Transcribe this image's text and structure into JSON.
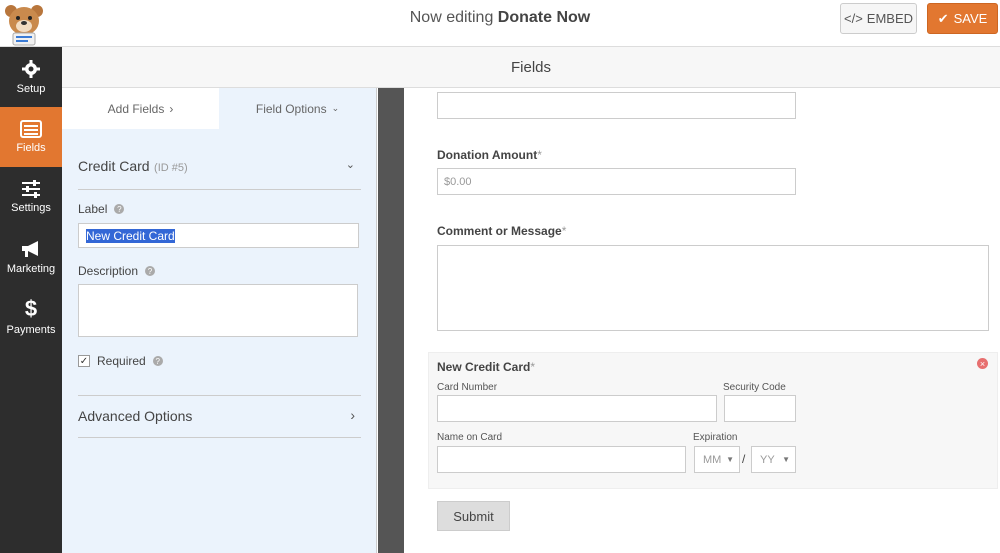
{
  "header": {
    "editing_prefix": "Now editing",
    "form_name": "Donate Now",
    "embed_label": "EMBED",
    "save_label": "SAVE"
  },
  "nav": {
    "items": [
      {
        "label": "Setup",
        "icon": "gear-icon"
      },
      {
        "label": "Fields",
        "icon": "list-icon",
        "active": true
      },
      {
        "label": "Settings",
        "icon": "sliders-icon"
      },
      {
        "label": "Marketing",
        "icon": "megaphone-icon"
      },
      {
        "label": "Payments",
        "icon": "dollar-icon"
      }
    ]
  },
  "fields_header": "Fields",
  "panel": {
    "tab_add": "Add Fields",
    "tab_options": "Field Options",
    "field_title": "Credit Card",
    "field_id": "(ID #5)",
    "label_label": "Label",
    "label_value": "New Credit Card",
    "description_label": "Description",
    "description_value": "",
    "required_label": "Required",
    "required_checked": true,
    "advanced_label": "Advanced Options"
  },
  "preview": {
    "donation_label": "Donation Amount",
    "donation_placeholder": "$0.00",
    "comment_label": "Comment or Message",
    "cc_label": "New Credit Card",
    "card_number_label": "Card Number",
    "security_code_label": "Security Code",
    "name_on_card_label": "Name on Card",
    "expiration_label": "Expiration",
    "month_placeholder": "MM",
    "year_placeholder": "YY",
    "separator": "/",
    "required_mark": "*",
    "submit_label": "Submit"
  },
  "colors": {
    "accent": "#e27730",
    "sidebar": "#2d2d2d",
    "panel_bg": "#ebf3fc"
  }
}
